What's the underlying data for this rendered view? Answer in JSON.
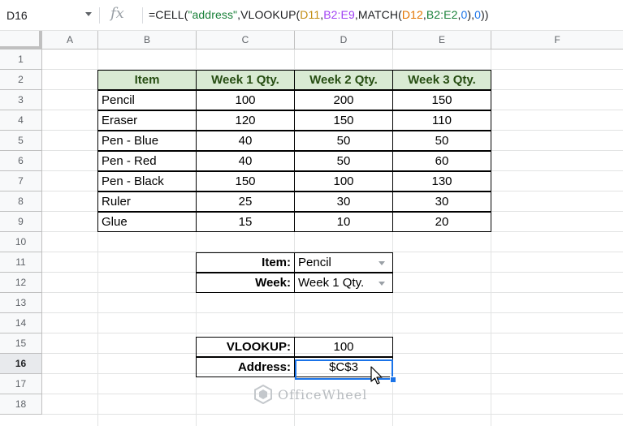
{
  "formula_bar": {
    "name_box": "D16",
    "fx_label": "fx",
    "formula_parts": [
      "=CELL(",
      "\"address\"",
      ",VLOOKUP(",
      "D11",
      ",",
      "B2:E9",
      ",MATCH(",
      "D12",
      ",",
      "B2:E2",
      ",",
      "0",
      "),",
      "0",
      "))"
    ]
  },
  "columns": [
    "A",
    "B",
    "C",
    "D",
    "E",
    "F"
  ],
  "rows": [
    "1",
    "2",
    "3",
    "4",
    "5",
    "6",
    "7",
    "8",
    "9",
    "10",
    "11",
    "12",
    "13",
    "14",
    "15",
    "16",
    "17",
    "18"
  ],
  "table": {
    "headers": [
      "Item",
      "Week 1 Qty.",
      "Week 2 Qty.",
      "Week 3 Qty."
    ],
    "rows": [
      [
        "Pencil",
        "100",
        "200",
        "150"
      ],
      [
        "Eraser",
        "120",
        "150",
        "110"
      ],
      [
        "Pen - Blue",
        "40",
        "50",
        "50"
      ],
      [
        "Pen - Red",
        "40",
        "50",
        "60"
      ],
      [
        "Pen - Black",
        "150",
        "100",
        "130"
      ],
      [
        "Ruler",
        "25",
        "30",
        "30"
      ],
      [
        "Glue",
        "15",
        "10",
        "20"
      ]
    ]
  },
  "lookup": {
    "item_label": "Item:",
    "item_value": "Pencil",
    "week_label": "Week:",
    "week_value": "Week 1 Qty."
  },
  "results": {
    "vlookup_label": "VLOOKUP:",
    "vlookup_value": "100",
    "address_label": "Address:",
    "address_value": "$C$3"
  },
  "active_row": "16",
  "watermark": "OfficeWheel",
  "colors": {
    "header_fill": "#d9ead3",
    "selection": "#1a73e8"
  }
}
